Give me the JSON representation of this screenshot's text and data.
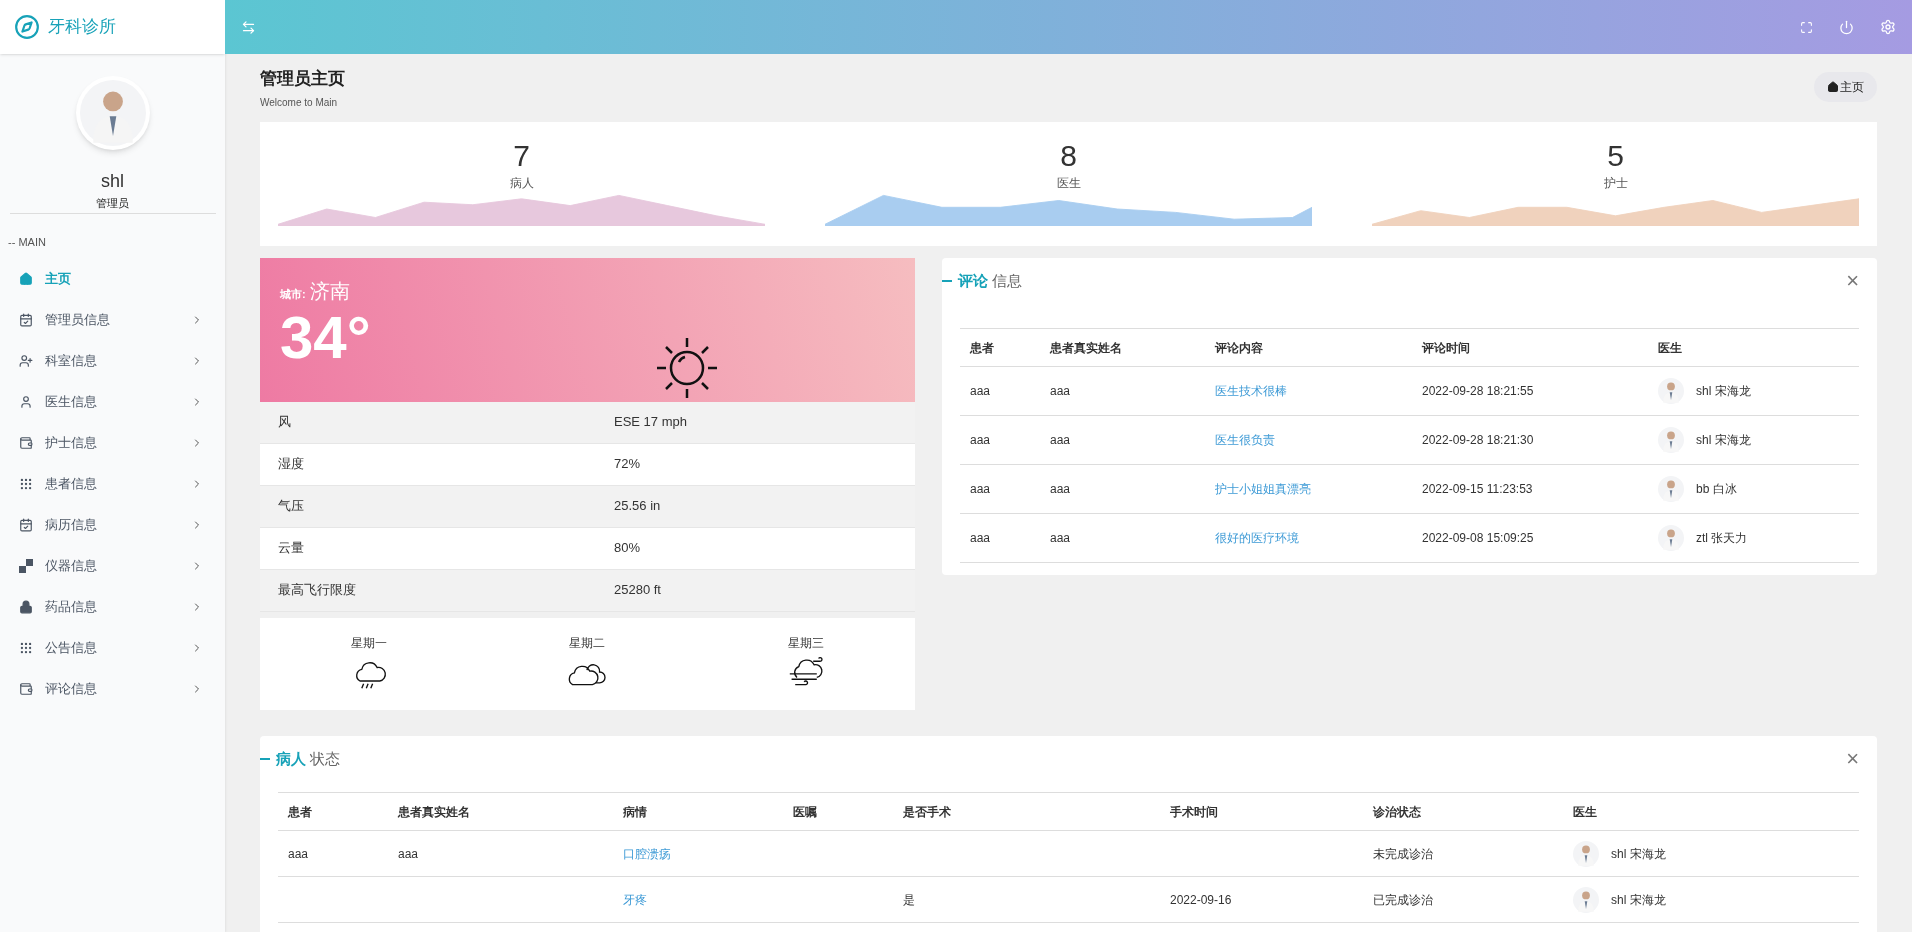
{
  "brand": {
    "title": "牙科诊所"
  },
  "profile": {
    "name": "shl",
    "role": "管理员"
  },
  "sidebar": {
    "section": "-- MAIN",
    "items": [
      {
        "label": "主页",
        "selected": true,
        "expandable": false
      },
      {
        "label": "管理员信息",
        "selected": false,
        "expandable": true
      },
      {
        "label": "科室信息",
        "selected": false,
        "expandable": true
      },
      {
        "label": "医生信息",
        "selected": false,
        "expandable": true
      },
      {
        "label": "护士信息",
        "selected": false,
        "expandable": true
      },
      {
        "label": "患者信息",
        "selected": false,
        "expandable": true
      },
      {
        "label": "病历信息",
        "selected": false,
        "expandable": true
      },
      {
        "label": "仪器信息",
        "selected": false,
        "expandable": true
      },
      {
        "label": "药品信息",
        "selected": false,
        "expandable": true
      },
      {
        "label": "公告信息",
        "selected": false,
        "expandable": true
      },
      {
        "label": "评论信息",
        "selected": false,
        "expandable": true
      }
    ]
  },
  "page": {
    "title": "管理员主页",
    "subtitle": "Welcome to Main",
    "breadcrumb": "主页"
  },
  "stats": [
    {
      "value": "7",
      "label": "病人",
      "color": "#e7c8dd"
    },
    {
      "value": "8",
      "label": "医生",
      "color": "#a9cdf0"
    },
    {
      "value": "5",
      "label": "护士",
      "color": "#f0d2bd"
    }
  ],
  "weather": {
    "city_label": "城市:",
    "city": "济南",
    "temperature": "34°",
    "rows": [
      {
        "label": "风",
        "value": "ESE 17 mph"
      },
      {
        "label": "湿度",
        "value": "72%"
      },
      {
        "label": "气压",
        "value": "25.56 in"
      },
      {
        "label": "云量",
        "value": "80%"
      },
      {
        "label": "最高飞行限度",
        "value": "25280 ft"
      }
    ],
    "forecast": [
      {
        "day": "星期一",
        "kind": "rain"
      },
      {
        "day": "星期二",
        "kind": "cloudy"
      },
      {
        "day": "星期三",
        "kind": "wind"
      }
    ]
  },
  "comments": {
    "title_bold": "评论",
    "title_rest": "信息",
    "close": "×",
    "columns": [
      "患者",
      "患者真实姓名",
      "评论内容",
      "评论时间",
      "医生"
    ],
    "rows": [
      {
        "patient": "aaa",
        "real_name": "aaa",
        "content": "医生技术很棒",
        "time": "2022-09-28 18:21:55",
        "doctor": "shl 宋海龙"
      },
      {
        "patient": "aaa",
        "real_name": "aaa",
        "content": "医生很负责",
        "time": "2022-09-28 18:21:30",
        "doctor": "shl 宋海龙"
      },
      {
        "patient": "aaa",
        "real_name": "aaa",
        "content": "护士小姐姐真漂亮",
        "time": "2022-09-15 11:23:53",
        "doctor": "bb 白冰"
      },
      {
        "patient": "aaa",
        "real_name": "aaa",
        "content": "很好的医疗环境",
        "time": "2022-09-08 15:09:25",
        "doctor": "ztl 张天力"
      }
    ]
  },
  "patients": {
    "title_bold": "病人",
    "title_rest": "状态",
    "close": "×",
    "columns": [
      "患者",
      "患者真实姓名",
      "病情",
      "医嘱",
      "是否手术",
      "手术时间",
      "诊治状态",
      "医生"
    ],
    "rows": [
      {
        "patient": "aaa",
        "real_name": "aaa",
        "condition": "口腔溃疡",
        "advice": "",
        "surgery": "",
        "surgery_time": "",
        "status": "未完成诊治",
        "doctor": "shl 宋海龙"
      },
      {
        "patient": "",
        "real_name": "",
        "condition": "牙疼",
        "advice": "",
        "surgery": "是",
        "surgery_time": "2022-09-16",
        "status": "已完成诊治",
        "doctor": "shl 宋海龙"
      }
    ]
  }
}
